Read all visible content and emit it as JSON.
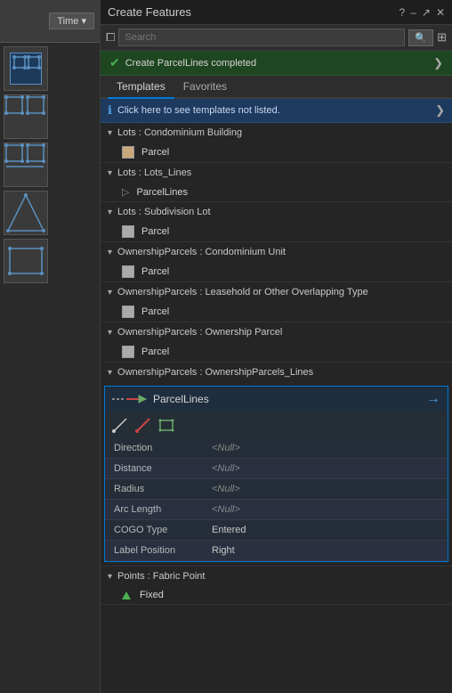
{
  "left_panel": {
    "time_button": "Time ▾"
  },
  "header": {
    "title": "Create Features",
    "icons": [
      "?",
      "-",
      "↗",
      "✕"
    ]
  },
  "search": {
    "placeholder": "Search",
    "filter_label": "filter",
    "go_label": "🔍"
  },
  "success_banner": {
    "message": "Create ParcelLines completed",
    "close": "❯"
  },
  "tabs": [
    {
      "label": "Templates",
      "active": true
    },
    {
      "label": "Favorites",
      "active": false
    }
  ],
  "info_bar": {
    "text": "Click here to see templates not listed.",
    "arrow": "❯"
  },
  "categories": [
    {
      "label": "Lots : Condominium Building",
      "items": [
        {
          "type": "parcel",
          "label": "Parcel"
        }
      ]
    },
    {
      "label": "Lots : Lots_Lines",
      "items": [
        {
          "type": "line",
          "label": "ParcelLines"
        }
      ]
    },
    {
      "label": "Lots : Subdivision Lot",
      "items": [
        {
          "type": "parcel",
          "label": "Parcel"
        }
      ]
    },
    {
      "label": "OwnershipParcels : Condominium Unit",
      "items": [
        {
          "type": "parcel",
          "label": "Parcel"
        }
      ]
    },
    {
      "label": "OwnershipParcels : Leasehold or Other Overlapping Type",
      "items": [
        {
          "type": "parcel",
          "label": "Parcel"
        }
      ]
    },
    {
      "label": "OwnershipParcels : Ownership Parcel",
      "items": [
        {
          "type": "parcel",
          "label": "Parcel"
        }
      ]
    },
    {
      "label": "OwnershipParcels : OwnershipParcels_Lines",
      "items": []
    }
  ],
  "selected_item": {
    "name": "ParcelLines",
    "attributes": [
      {
        "field": "Direction",
        "value": "<Null>"
      },
      {
        "field": "Distance",
        "value": "<Null>"
      },
      {
        "field": "Radius",
        "value": "<Null>"
      },
      {
        "field": "Arc Length",
        "value": "<Null>"
      },
      {
        "field": "COGO Type",
        "value": "Entered"
      },
      {
        "field": "Label Position",
        "value": "Right"
      }
    ]
  },
  "points_section": {
    "label": "Points : Fabric Point",
    "items": [
      {
        "type": "triangle",
        "label": "Fixed"
      }
    ]
  }
}
